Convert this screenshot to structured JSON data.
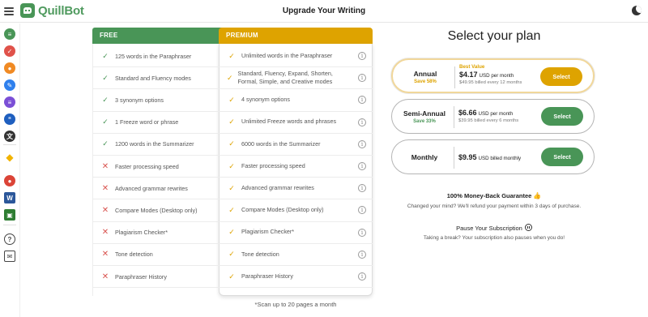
{
  "app": {
    "name": "QuillBot",
    "page_title": "Upgrade Your Writing"
  },
  "sidebar": {
    "items": [
      {
        "icon": "paraphraser-icon",
        "color": "#499557"
      },
      {
        "icon": "grammar-checker-icon",
        "color": "#e0524a"
      },
      {
        "icon": "plagiarism-checker-icon",
        "color": "#f08a24"
      },
      {
        "icon": "co-writer-icon",
        "color": "#2f80ed"
      },
      {
        "icon": "summarizer-icon",
        "color": "#7b4fd6"
      },
      {
        "icon": "citation-generator-icon",
        "color": "#1f5fbf"
      },
      {
        "icon": "translator-icon",
        "color": "#333333"
      },
      {
        "icon": "premium-diamond-icon",
        "color": "#f2b300"
      },
      {
        "icon": "chrome-extension-icon",
        "color": "#db4437"
      },
      {
        "icon": "word-extension-icon",
        "color": "#2b579a"
      },
      {
        "icon": "desktop-app-icon",
        "color": "#2e7d32"
      },
      {
        "icon": "help-icon",
        "color": "#444444"
      },
      {
        "icon": "mail-icon",
        "color": "#444444"
      }
    ]
  },
  "comparison": {
    "free_header": "FREE",
    "premium_header": "PREMIUM",
    "rows": [
      {
        "free": "125 words in the Paraphraser",
        "free_included": true,
        "premium": "Unlimited words in the Paraphraser"
      },
      {
        "free": "Standard and Fluency modes",
        "free_included": true,
        "premium": "Standard, Fluency, Expand, Shorten, Formal, Simple, and Creative modes"
      },
      {
        "free": "3 synonym options",
        "free_included": true,
        "premium": "4 synonym options"
      },
      {
        "free": "1 Freeze word or phrase",
        "free_included": true,
        "premium": "Unlimited Freeze words and phrases"
      },
      {
        "free": "1200 words in the Summarizer",
        "free_included": true,
        "premium": "6000 words in the Summarizer"
      },
      {
        "free": "Faster processing speed",
        "free_included": false,
        "premium": "Faster processing speed"
      },
      {
        "free": "Advanced grammar rewrites",
        "free_included": false,
        "premium": "Advanced grammar rewrites"
      },
      {
        "free": "Compare Modes (Desktop only)",
        "free_included": false,
        "premium": "Compare Modes (Desktop only)"
      },
      {
        "free": "Plagiarism Checker*",
        "free_included": false,
        "premium": "Plagiarism Checker*"
      },
      {
        "free": "Tone detection",
        "free_included": false,
        "premium": "Tone detection"
      },
      {
        "free": "Paraphraser History",
        "free_included": false,
        "premium": "Paraphraser History"
      }
    ],
    "footnote": "*Scan up to 20 pages a month",
    "colors": {
      "free": "#499557",
      "premium": "#dea300",
      "cross": "#d9534f"
    }
  },
  "plans": {
    "title": "Select your plan",
    "items": [
      {
        "name": "Annual",
        "save": "Save 58%",
        "best_value": "Best Value",
        "price": "$4.17",
        "price_suffix": "USD per month",
        "billed": "$49.95 billed every 12 months",
        "button": "Select",
        "button_color": "#dea300",
        "save_color": "#dea300"
      },
      {
        "name": "Semi-Annual",
        "save": "Save 33%",
        "best_value": "",
        "price": "$6.66",
        "price_suffix": "USD per month",
        "billed": "$39.95 billed every 6 months",
        "button": "Select",
        "button_color": "#499557",
        "save_color": "#499557"
      },
      {
        "name": "Monthly",
        "save": "",
        "best_value": "",
        "price": "$9.95",
        "price_suffix": "USD billed monthly",
        "billed": "",
        "button": "Select",
        "button_color": "#499557",
        "save_color": "#499557"
      }
    ]
  },
  "guarantee": {
    "title": "100% Money-Back Guarantee",
    "text": "Changed your mind? We'll refund your payment within 3 days of purchase."
  },
  "pause": {
    "title": "Pause Your Subscription",
    "text": "Taking a break? Your subscription also pauses when you do!"
  }
}
